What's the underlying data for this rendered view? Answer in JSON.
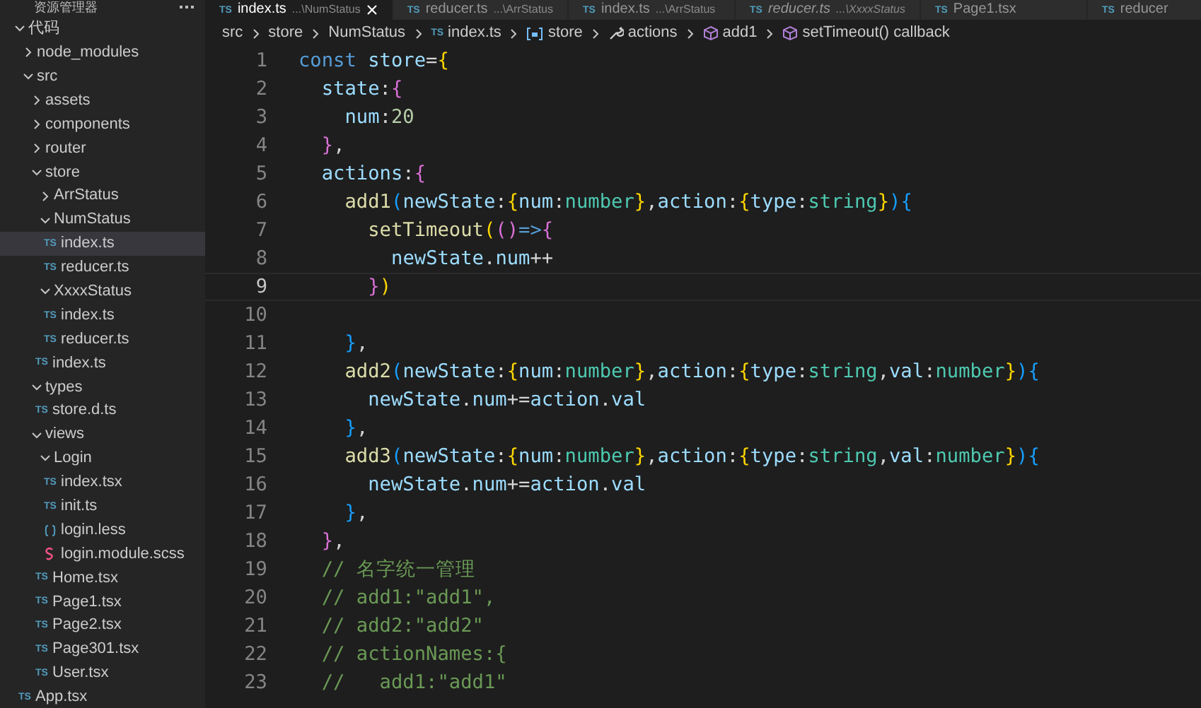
{
  "sidebar": {
    "title": "资源管理器",
    "tree": [
      {
        "label": "代码",
        "kind": "folder",
        "expanded": true,
        "selected": false,
        "children": [
          {
            "label": "node_modules",
            "kind": "folder",
            "expanded": false,
            "selected": false
          },
          {
            "label": "src",
            "kind": "folder",
            "expanded": true,
            "selected": false,
            "children": [
              {
                "label": "assets",
                "kind": "folder",
                "expanded": false,
                "selected": false
              },
              {
                "label": "components",
                "kind": "folder",
                "expanded": false,
                "selected": false
              },
              {
                "label": "router",
                "kind": "folder",
                "expanded": false,
                "selected": false
              },
              {
                "label": "store",
                "kind": "folder",
                "expanded": true,
                "selected": false,
                "children": [
                  {
                    "label": "ArrStatus",
                    "kind": "folder",
                    "expanded": false,
                    "selected": false
                  },
                  {
                    "label": "NumStatus",
                    "kind": "folder",
                    "expanded": true,
                    "selected": false,
                    "children": [
                      {
                        "label": "index.ts",
                        "kind": "ts",
                        "icon": "TS",
                        "selected": true
                      },
                      {
                        "label": "reducer.ts",
                        "kind": "ts",
                        "icon": "TS",
                        "selected": false
                      }
                    ]
                  },
                  {
                    "label": "XxxxStatus",
                    "kind": "folder",
                    "expanded": true,
                    "selected": false,
                    "children": [
                      {
                        "label": "index.ts",
                        "kind": "ts",
                        "icon": "TS",
                        "selected": false
                      },
                      {
                        "label": "reducer.ts",
                        "kind": "ts",
                        "icon": "TS",
                        "selected": false
                      }
                    ]
                  },
                  {
                    "label": "index.ts",
                    "kind": "ts",
                    "icon": "TS",
                    "selected": false
                  }
                ]
              },
              {
                "label": "types",
                "kind": "folder",
                "expanded": true,
                "selected": false,
                "children": [
                  {
                    "label": "store.d.ts",
                    "kind": "ts",
                    "icon": "TS",
                    "selected": false
                  }
                ]
              },
              {
                "label": "views",
                "kind": "folder",
                "expanded": true,
                "selected": false,
                "children": [
                  {
                    "label": "Login",
                    "kind": "folder",
                    "expanded": true,
                    "selected": false,
                    "children": [
                      {
                        "label": "index.tsx",
                        "kind": "ts",
                        "icon": "TS",
                        "selected": false
                      },
                      {
                        "label": "init.ts",
                        "kind": "ts",
                        "icon": "TS",
                        "selected": false
                      },
                      {
                        "label": "login.less",
                        "kind": "less",
                        "selected": false
                      },
                      {
                        "label": "login.module.scss",
                        "kind": "scss",
                        "selected": false
                      }
                    ]
                  },
                  {
                    "label": "Home.tsx",
                    "kind": "ts",
                    "icon": "TS",
                    "selected": false
                  },
                  {
                    "label": "Page1.tsx",
                    "kind": "ts",
                    "icon": "TS",
                    "selected": false
                  },
                  {
                    "label": "Page2.tsx",
                    "kind": "ts",
                    "icon": "TS",
                    "selected": false
                  },
                  {
                    "label": "Page301.tsx",
                    "kind": "ts",
                    "icon": "TS",
                    "selected": false
                  },
                  {
                    "label": "User.tsx",
                    "kind": "ts",
                    "icon": "TS",
                    "selected": false
                  }
                ]
              }
            ]
          },
          {
            "label": "App.tsx",
            "kind": "ts",
            "icon": "TS",
            "selected": false
          }
        ]
      }
    ]
  },
  "tabs": [
    {
      "icon": "TS",
      "label": "index.ts",
      "path": "...\\NumStatus",
      "selected": true,
      "preview": false
    },
    {
      "icon": "TS",
      "label": "reducer.ts",
      "path": "...\\ArrStatus",
      "selected": false,
      "preview": false
    },
    {
      "icon": "TS",
      "label": "index.ts",
      "path": "...\\ArrStatus",
      "selected": false,
      "preview": false
    },
    {
      "icon": "TS",
      "label": "reducer.ts",
      "path": "...\\XxxxStatus",
      "selected": false,
      "preview": true
    },
    {
      "icon": "TS",
      "label": "Page1.tsx",
      "selected": false,
      "preview": false
    },
    {
      "icon": "TS",
      "label": "reducer",
      "selected": false,
      "preview": false
    }
  ],
  "breadcrumbs": [
    {
      "label": "src",
      "kind": "folder"
    },
    {
      "label": "store",
      "kind": "folder"
    },
    {
      "label": "NumStatus",
      "kind": "folder"
    },
    {
      "label": "index.ts",
      "kind": "ts",
      "icon": "TS"
    },
    {
      "label": "store",
      "kind": "variable"
    },
    {
      "label": "actions",
      "kind": "property"
    },
    {
      "label": "add1",
      "kind": "method"
    },
    {
      "label": "setTimeout() callback",
      "kind": "method"
    }
  ],
  "code": [
    {
      "number": "1",
      "current": false,
      "tokens": [
        {
          "text": "const",
          "kind": "kw"
        },
        {
          "text": "store",
          "kind": "var"
        },
        {
          "text": "=",
          "kind": "punct"
        },
        {
          "text": "{",
          "kind": "b1"
        }
      ]
    },
    {
      "number": "2",
      "current": false,
      "tokens": [
        {
          "text": "state",
          "kind": "var"
        },
        {
          "text": ":",
          "kind": "punct"
        },
        {
          "text": "{",
          "kind": "b2"
        }
      ]
    },
    {
      "number": "3",
      "current": false,
      "tokens": [
        {
          "text": "num",
          "kind": "var"
        },
        {
          "text": ":",
          "kind": "punct"
        },
        {
          "text": "20",
          "kind": "num"
        }
      ]
    },
    {
      "number": "4",
      "current": false,
      "tokens": [
        {
          "text": "}",
          "kind": "b2"
        },
        {
          "text": ",",
          "kind": "punct"
        }
      ]
    },
    {
      "number": "5",
      "current": false,
      "tokens": [
        {
          "text": "actions",
          "kind": "var"
        },
        {
          "text": ":",
          "kind": "punct"
        },
        {
          "text": "{",
          "kind": "b2"
        }
      ]
    },
    {
      "number": "6",
      "current": false,
      "tokens": [
        {
          "text": "add1",
          "kind": "fn"
        },
        {
          "text": "(",
          "kind": "b3"
        },
        {
          "text": "newState",
          "kind": "var"
        },
        {
          "text": ":",
          "kind": "punct"
        },
        {
          "text": "{",
          "kind": "b1"
        },
        {
          "text": "num",
          "kind": "var"
        },
        {
          "text": ":",
          "kind": "punct"
        },
        {
          "text": "number",
          "kind": "type"
        },
        {
          "text": "}",
          "kind": "b1"
        },
        {
          "text": ",",
          "kind": "punct"
        },
        {
          "text": "action",
          "kind": "var"
        },
        {
          "text": ":",
          "kind": "punct"
        },
        {
          "text": "{",
          "kind": "b1"
        },
        {
          "text": "type",
          "kind": "var"
        },
        {
          "text": ":",
          "kind": "punct"
        },
        {
          "text": "string",
          "kind": "type"
        },
        {
          "text": "}",
          "kind": "b1"
        },
        {
          "text": ")",
          "kind": "b3"
        },
        {
          "text": "{",
          "kind": "b3"
        }
      ]
    },
    {
      "number": "7",
      "current": false,
      "tokens": [
        {
          "text": "setTimeout",
          "kind": "fn"
        },
        {
          "text": "(",
          "kind": "b1"
        },
        {
          "text": "(",
          "kind": "b2"
        },
        {
          "text": ")",
          "kind": "b2"
        },
        {
          "text": "=>",
          "kind": "kw"
        },
        {
          "text": "{",
          "kind": "b2"
        }
      ]
    },
    {
      "number": "8",
      "current": false,
      "tokens": [
        {
          "text": "newState",
          "kind": "var"
        },
        {
          "text": ".",
          "kind": "punct"
        },
        {
          "text": "num",
          "kind": "var"
        },
        {
          "text": "++",
          "kind": "punct"
        }
      ]
    },
    {
      "number": "9",
      "current": true,
      "tokens": [
        {
          "text": "}",
          "kind": "b2"
        },
        {
          "text": ")",
          "kind": "b1"
        }
      ]
    },
    {
      "number": "10",
      "current": false
    },
    {
      "number": "11",
      "current": false,
      "tokens": [
        {
          "text": "}",
          "kind": "b3"
        },
        {
          "text": ",",
          "kind": "punct"
        }
      ]
    },
    {
      "number": "12",
      "current": false,
      "tokens": [
        {
          "text": "add2",
          "kind": "fn"
        },
        {
          "text": "(",
          "kind": "b3"
        },
        {
          "text": "newState",
          "kind": "var"
        },
        {
          "text": ":",
          "kind": "punct"
        },
        {
          "text": "{",
          "kind": "b1"
        },
        {
          "text": "num",
          "kind": "var"
        },
        {
          "text": ":",
          "kind": "punct"
        },
        {
          "text": "number",
          "kind": "type"
        },
        {
          "text": "}",
          "kind": "b1"
        },
        {
          "text": ",",
          "kind": "punct"
        },
        {
          "text": "action",
          "kind": "var"
        },
        {
          "text": ":",
          "kind": "punct"
        },
        {
          "text": "{",
          "kind": "b1"
        },
        {
          "text": "type",
          "kind": "var"
        },
        {
          "text": ":",
          "kind": "punct"
        },
        {
          "text": "string",
          "kind": "type"
        },
        {
          "text": ",",
          "kind": "punct"
        },
        {
          "text": "val",
          "kind": "var"
        },
        {
          "text": ":",
          "kind": "punct"
        },
        {
          "text": "number",
          "kind": "type"
        },
        {
          "text": "}",
          "kind": "b1"
        },
        {
          "text": ")",
          "kind": "b3"
        },
        {
          "text": "{",
          "kind": "b3"
        }
      ]
    },
    {
      "number": "13",
      "current": false,
      "tokens": [
        {
          "text": "newState",
          "kind": "var"
        },
        {
          "text": ".",
          "kind": "punct"
        },
        {
          "text": "num",
          "kind": "var"
        },
        {
          "text": "+=",
          "kind": "punct"
        },
        {
          "text": "action",
          "kind": "var"
        },
        {
          "text": ".",
          "kind": "punct"
        },
        {
          "text": "val",
          "kind": "var"
        }
      ]
    },
    {
      "number": "14",
      "current": false,
      "tokens": [
        {
          "text": "}",
          "kind": "b3"
        },
        {
          "text": ",",
          "kind": "punct"
        }
      ]
    },
    {
      "number": "15",
      "current": false,
      "tokens": [
        {
          "text": "add3",
          "kind": "fn"
        },
        {
          "text": "(",
          "kind": "b3"
        },
        {
          "text": "newState",
          "kind": "var"
        },
        {
          "text": ":",
          "kind": "punct"
        },
        {
          "text": "{",
          "kind": "b1"
        },
        {
          "text": "num",
          "kind": "var"
        },
        {
          "text": ":",
          "kind": "punct"
        },
        {
          "text": "number",
          "kind": "type"
        },
        {
          "text": "}",
          "kind": "b1"
        },
        {
          "text": ",",
          "kind": "punct"
        },
        {
          "text": "action",
          "kind": "var"
        },
        {
          "text": ":",
          "kind": "punct"
        },
        {
          "text": "{",
          "kind": "b1"
        },
        {
          "text": "type",
          "kind": "var"
        },
        {
          "text": ":",
          "kind": "punct"
        },
        {
          "text": "string",
          "kind": "type"
        },
        {
          "text": ",",
          "kind": "punct"
        },
        {
          "text": "val",
          "kind": "var"
        },
        {
          "text": ":",
          "kind": "punct"
        },
        {
          "text": "number",
          "kind": "type"
        },
        {
          "text": "}",
          "kind": "b1"
        },
        {
          "text": ")",
          "kind": "b3"
        },
        {
          "text": "{",
          "kind": "b3"
        }
      ]
    },
    {
      "number": "16",
      "current": false,
      "tokens": [
        {
          "text": "newState",
          "kind": "var"
        },
        {
          "text": ".",
          "kind": "punct"
        },
        {
          "text": "num",
          "kind": "var"
        },
        {
          "text": "+=",
          "kind": "punct"
        },
        {
          "text": "action",
          "kind": "var"
        },
        {
          "text": ".",
          "kind": "punct"
        },
        {
          "text": "val",
          "kind": "var"
        }
      ]
    },
    {
      "number": "17",
      "current": false,
      "tokens": [
        {
          "text": "}",
          "kind": "b3"
        },
        {
          "text": ",",
          "kind": "punct"
        }
      ]
    },
    {
      "number": "18",
      "current": false,
      "tokens": [
        {
          "text": "}",
          "kind": "b2"
        },
        {
          "text": ",",
          "kind": "punct"
        }
      ]
    },
    {
      "number": "19",
      "current": false,
      "tokens": [
        {
          "text": "// 名字统一管理",
          "kind": "comment"
        }
      ]
    },
    {
      "number": "20",
      "current": false,
      "tokens": [
        {
          "text": "// add1:\"add1\",",
          "kind": "comment"
        }
      ]
    },
    {
      "number": "21",
      "current": false,
      "tokens": [
        {
          "text": "// add2:\"add2\"",
          "kind": "comment"
        }
      ]
    },
    {
      "number": "22",
      "current": false,
      "tokens": [
        {
          "text": "// actionNames:{",
          "kind": "comment"
        }
      ]
    },
    {
      "number": "23",
      "current": false,
      "tokens": [
        {
          "text": "//   add1:\"add1\"",
          "kind": "comment"
        }
      ]
    }
  ]
}
